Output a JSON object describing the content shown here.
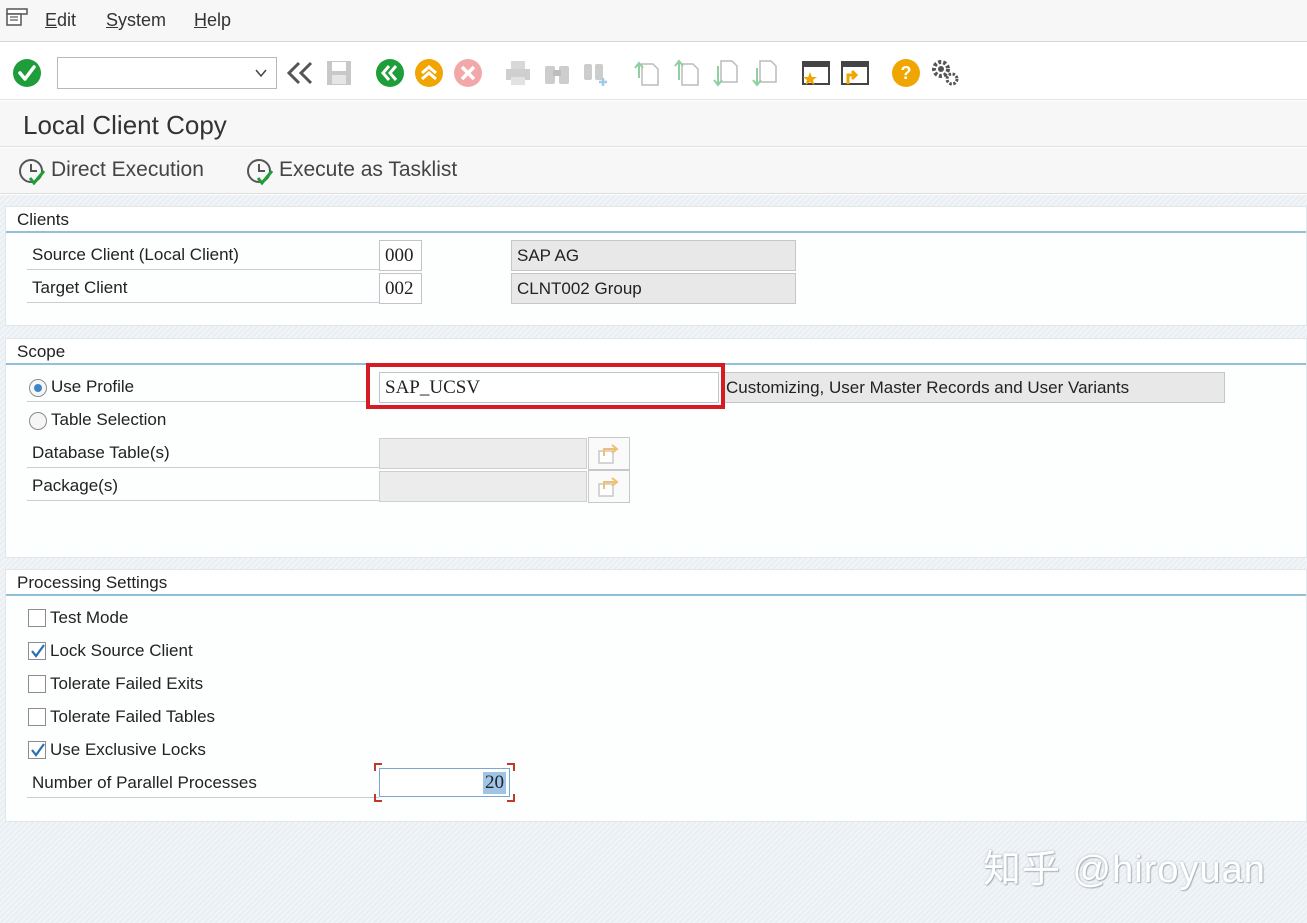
{
  "menubar": {
    "items": [
      {
        "label": "Edit",
        "mnemonic": "E"
      },
      {
        "label": "System",
        "mnemonic": "S"
      },
      {
        "label": "Help",
        "mnemonic": "H"
      }
    ]
  },
  "toolbar": {
    "command_field_value": "",
    "icons": [
      "enter-icon",
      "back-double-icon",
      "save-icon",
      "back-icon",
      "exit-icon",
      "cancel-icon",
      "print-icon",
      "find-icon",
      "find-next-icon",
      "first-page-icon",
      "previous-page-icon",
      "next-page-icon",
      "last-page-icon",
      "create-session-icon",
      "shortcut-icon",
      "help-icon",
      "settings-icon"
    ]
  },
  "title": "Local Client Copy",
  "app_toolbar": {
    "direct_execution": "Direct Execution",
    "execute_as_tasklist": "Execute as Tasklist"
  },
  "clients": {
    "heading": "Clients",
    "source_label": "Source Client (Local Client)",
    "source_value": "000",
    "source_desc": "SAP AG",
    "target_label": "Target Client",
    "target_value": "002",
    "target_desc": "CLNT002 Group"
  },
  "scope": {
    "heading": "Scope",
    "use_profile_label": "Use Profile",
    "use_profile_selected": true,
    "profile_value": "SAP_UCSV",
    "profile_desc": "Customizing, User Master Records and User Variants",
    "table_selection_label": "Table Selection",
    "table_selection_selected": false,
    "database_tables_label": "Database Table(s)",
    "packages_label": "Package(s)"
  },
  "processing": {
    "heading": "Processing Settings",
    "options": [
      {
        "label": "Test Mode",
        "checked": false
      },
      {
        "label": "Lock Source Client",
        "checked": true
      },
      {
        "label": "Tolerate Failed Exits",
        "checked": false
      },
      {
        "label": "Tolerate Failed Tables",
        "checked": false
      },
      {
        "label": "Use Exclusive Locks",
        "checked": true
      }
    ],
    "parallel_label": "Number of Parallel Processes",
    "parallel_value": "20"
  },
  "watermark": "知乎 @hiroyuan",
  "colors": {
    "highlight": "#d61b24",
    "accent_green": "#1f9d3a",
    "accent_yellow": "#f0a500",
    "section_rule": "#8fc2d8"
  }
}
